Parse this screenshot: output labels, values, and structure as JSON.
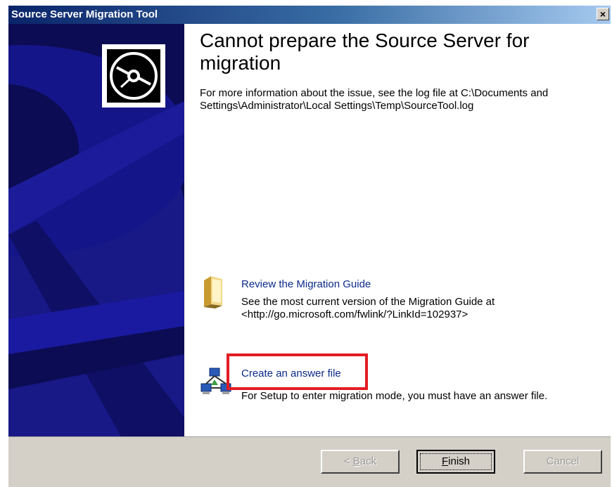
{
  "window": {
    "title": "Source Server Migration Tool",
    "close_glyph": "×"
  },
  "content": {
    "heading": "Cannot prepare the Source Server for migration",
    "info": "For more information about the issue, see the log file at C:\\Documents and Settings\\Administrator\\Local Settings\\Temp\\SourceTool.log",
    "items": [
      {
        "icon": "folder-book-icon",
        "link": "Review the Migration Guide",
        "desc": "See the most current version of the Migration Guide at <http://go.microsoft.com/fwlink/?LinkId=102937>"
      },
      {
        "icon": "network-computers-icon",
        "link": "Create an answer file",
        "desc": "For Setup to enter migration mode, you must have an answer file."
      }
    ]
  },
  "buttons": {
    "back": {
      "accel": "B",
      "rest": "ack",
      "prefix": "< "
    },
    "finish": {
      "accel": "F",
      "rest": "inish"
    },
    "cancel": {
      "label": "Cancel"
    }
  },
  "colors": {
    "highlight": "#e31c23",
    "link": "#0a2a8a",
    "panel": "#0c0c54"
  }
}
